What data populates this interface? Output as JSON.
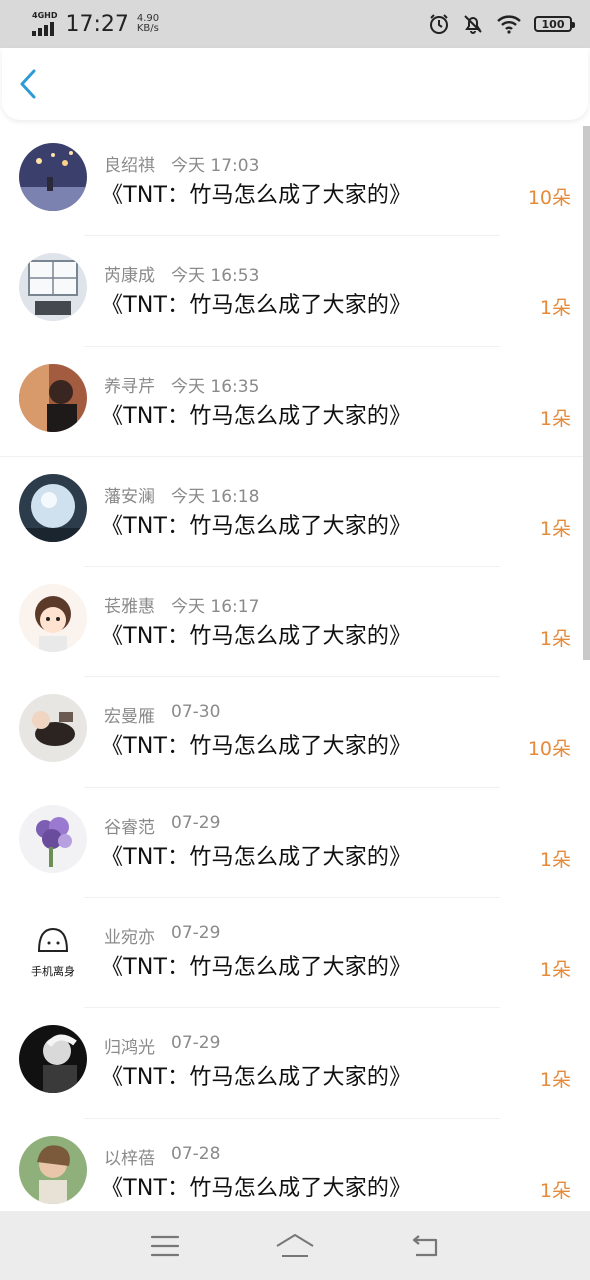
{
  "status_bar": {
    "network": "4GHD",
    "time": "17:27",
    "speed_value": "4.90",
    "speed_unit": "KB/s",
    "battery": "100",
    "icons": [
      "alarm-icon",
      "mute-icon",
      "wifi-icon",
      "battery-icon"
    ]
  },
  "header": {
    "back_icon": "chevron-left-icon",
    "accent_color": "#2c9bd6"
  },
  "list": {
    "amount_color": "#e58a3a",
    "items": [
      {
        "name": "良绍祺",
        "time": "今天 17:03",
        "title": "《TNT：竹马怎么成了大家的》",
        "amount": "10朵"
      },
      {
        "name": "芮康成",
        "time": "今天 16:53",
        "title": "《TNT：竹马怎么成了大家的》",
        "amount": "1朵"
      },
      {
        "name": "养寻芹",
        "time": "今天 16:35",
        "title": "《TNT：竹马怎么成了大家的》",
        "amount": "1朵"
      },
      {
        "name": "藩安澜",
        "time": "今天 16:18",
        "title": "《TNT：竹马怎么成了大家的》",
        "amount": "1朵"
      },
      {
        "name": "苌雅惠",
        "time": "今天 16:17",
        "title": "《TNT：竹马怎么成了大家的》",
        "amount": "1朵"
      },
      {
        "name": "宏曼雁",
        "time": "07-30",
        "title": "《TNT：竹马怎么成了大家的》",
        "amount": "10朵"
      },
      {
        "name": "谷睿范",
        "time": "07-29",
        "title": "《TNT：竹马怎么成了大家的》",
        "amount": "1朵"
      },
      {
        "name": "业宛亦",
        "time": "07-29",
        "title": "《TNT：竹马怎么成了大家的》",
        "amount": "1朵"
      },
      {
        "name": "归鸿光",
        "time": "07-29",
        "title": "《TNT：竹马怎么成了大家的》",
        "amount": "1朵"
      },
      {
        "name": "以梓蓓",
        "time": "07-28",
        "title": "《TNT：竹马怎么成了大家的》",
        "amount": "1朵"
      }
    ],
    "avatar_8_text": "手机离身"
  },
  "nav_bar": {
    "icons": [
      "menu-icon",
      "home-icon",
      "back-icon"
    ]
  }
}
